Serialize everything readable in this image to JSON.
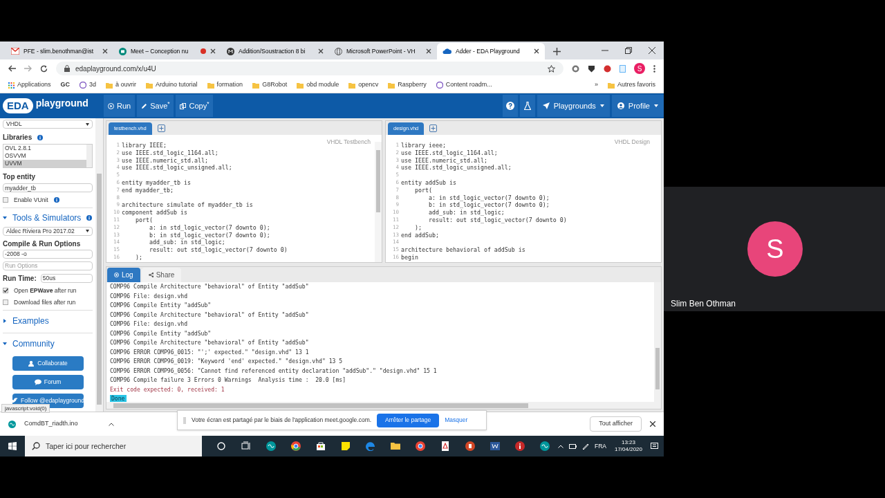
{
  "browser_tabs": [
    {
      "title": "PFE - slim.benothman@ist",
      "kind": "mail",
      "selected": false
    },
    {
      "title": "Meet – Conception nu",
      "kind": "meet",
      "selected": false
    },
    {
      "title": "Addition/Soustraction 8 bi",
      "kind": "site",
      "selected": false
    },
    {
      "title": "Microsoft PowerPoint - VH",
      "kind": "globe",
      "selected": false
    },
    {
      "title": "Adder - EDA Playground",
      "kind": "eda",
      "selected": true
    }
  ],
  "address": "edaplayground.com/x/u4U",
  "profile_initial": "S",
  "bookmarks": [
    {
      "label": "Applications",
      "kind": "apps"
    },
    {
      "label": "GC",
      "kind": "text"
    },
    {
      "label": "3d",
      "kind": "site"
    },
    {
      "label": "à ouvrir",
      "kind": "folder"
    },
    {
      "label": "Arduino tutorial",
      "kind": "folder"
    },
    {
      "label": "formation",
      "kind": "folder"
    },
    {
      "label": "G8Robot",
      "kind": "folder"
    },
    {
      "label": "obd module",
      "kind": "folder"
    },
    {
      "label": "opencv",
      "kind": "folder"
    },
    {
      "label": "Raspberry",
      "kind": "folder"
    },
    {
      "label": "Content roadm...",
      "kind": "site"
    }
  ],
  "more_bookmarks": "»",
  "other_bookmarks": "Autres favoris",
  "eda_header": {
    "logo": "EDA",
    "brand": "playground",
    "actions": [
      "Run",
      "Save$^{*}$",
      "Copy$^{*}$"
    ],
    "menus": [
      "Playgrounds",
      "Profile"
    ]
  },
  "sidebar": {
    "language": "VHDL",
    "libraries_label": "Libraries",
    "libraries": [
      {
        "name": "OVL 2.8.1",
        "selected": false
      },
      {
        "name": "OSVVM",
        "selected": false
      },
      {
        "name": "UVVM",
        "selected": true
      }
    ],
    "top_entity_label": "Top entity",
    "top_entity": "myadder_tb",
    "vunit": {
      "label": "Enable VUnit",
      "checked": false
    },
    "sections": [
      {
        "title": "Tools & Simulators",
        "expanded": true
      }
    ],
    "simulator": "Aldec Riviera Pro 2017.02",
    "compile_label": "Compile & Run Options",
    "compile_options": "-2008 -o",
    "run_options": {
      "placeholder": "Run Options"
    },
    "run_time_label": "Run Time:",
    "run_time": "50us",
    "options": [
      {
        "label": "Open **EPWave** after run",
        "checked": true
      },
      {
        "label": "Download files after run",
        "checked": false
      }
    ],
    "examples": {
      "title": "Examples",
      "expanded": false
    },
    "community": {
      "title": "Community",
      "expanded": true,
      "buttons": [
        "Collaborate",
        "Forum",
        "Follow @edaplayground"
      ]
    },
    "status_link": "javascript:void(0)"
  },
  "editors": [
    {
      "tab": "testbench.vhd",
      "label": "VHDL Testbench",
      "lines": [
        {
          "n": "1",
          "text": "library IEEE;"
        },
        {
          "n": "2",
          "text": "use IEEE.std_logic_1164.all;"
        },
        {
          "n": "3",
          "text": "use IEEE.numeric_std.all;"
        },
        {
          "n": "4",
          "text": "use IEEE.std_logic_unsigned.all;"
        },
        {
          "n": "5"
        },
        {
          "n": "6",
          "text": "entity myadder_tb is"
        },
        {
          "n": "7",
          "text": "end myadder_tb;"
        },
        {
          "n": "8"
        },
        {
          "n": "9",
          "text": "architecture simulate of myadder_tb is"
        },
        {
          "n": "10",
          "text": "component addSub is"
        },
        {
          "n": "11",
          "text": "    port("
        },
        {
          "n": "12",
          "text": "        a: in std_logic_vector(7 downto 0);"
        },
        {
          "n": "13",
          "text": "        b: in std_logic_vector(7 downto 0);"
        },
        {
          "n": "14",
          "text": "        add_sub: in std_logic;"
        },
        {
          "n": "15",
          "text": "        result: out std_logic_vector(7 downto 0)"
        },
        {
          "n": "16",
          "text": "    );"
        }
      ]
    },
    {
      "tab": "design.vhd",
      "label": "VHDL Design",
      "lines": [
        {
          "n": "1",
          "text": "library ieee;"
        },
        {
          "n": "2",
          "text": "use IEEE.std_logic_1164.all;"
        },
        {
          "n": "3",
          "text": "use IEEE.numeric_std.all;"
        },
        {
          "n": "4",
          "text": "use IEEE.std_logic_unsigned.all;"
        },
        {
          "n": "5"
        },
        {
          "n": "6",
          "text": "entity addSub is"
        },
        {
          "n": "7",
          "text": "    port("
        },
        {
          "n": "8",
          "text": "        a: in std_logic_vector(7 downto 0);"
        },
        {
          "n": "9",
          "text": "        b: in std_logic_vector(7 downto 0);"
        },
        {
          "n": "10",
          "text": "        add_sub: in std_logic;"
        },
        {
          "n": "11",
          "text": "        result: out std_logic_vector(7 downto 0)"
        },
        {
          "n": "12",
          "text": "    );"
        },
        {
          "n": "13",
          "text": "end addSub;"
        },
        {
          "n": "14"
        },
        {
          "n": "15",
          "text": "architecture behavioral of addSub is"
        },
        {
          "n": "16",
          "text": "begin"
        }
      ]
    }
  ],
  "log": {
    "tabs": [
      {
        "label": "Log",
        "selected": true
      },
      {
        "label": "Share",
        "selected": false
      }
    ],
    "lines": [
      {
        "text": "COMP96 Compile Architecture \"behavioral\" of Entity \"addSub\"",
        "kind": "info"
      },
      {
        "text": "COMP96 File: design.vhd",
        "kind": "info"
      },
      {
        "text": "COMP96 Compile Entity \"addSub\"",
        "kind": "info"
      },
      {
        "text": "COMP96 Compile Architecture \"behavioral\" of Entity \"addSub\"",
        "kind": "info"
      },
      {
        "text": "COMP96 File: design.vhd",
        "kind": "info"
      },
      {
        "text": "COMP96 Compile Entity \"addSub\"",
        "kind": "info"
      },
      {
        "text": "COMP96 Compile Architecture \"behavioral\" of Entity \"addSub\"",
        "kind": "info"
      },
      {
        "text": "COMP96 ERROR COMP96_0015: \"';' expected.\" \"design.vhd\" 13 1",
        "kind": "info"
      },
      {
        "text": "COMP96 ERROR COMP96_0019: \"Keyword 'end' expected.\" \"design.vhd\" 13 5",
        "kind": "info"
      },
      {
        "text": "COMP96 ERROR COMP96_0056: \"Cannot find referenced entity declaration \"addSub\".\" \"design.vhd\" 15 1",
        "kind": "info"
      },
      {
        "text": "COMP96 Compile failure 3 Errors 0 Warnings  Analysis time :  20.0 [ms]",
        "kind": "info"
      },
      {
        "text": "Exit code expected: 0, received: 1",
        "kind": "exit"
      }
    ],
    "done": "Done"
  },
  "download": {
    "file": "ComdBT_riadth.ino",
    "show_all": "Tout afficher"
  },
  "share_notice": {
    "text": "Votre écran est partagé par le biais de l'application meet.google.com.",
    "stop": "Arrêter le partage",
    "hide": "Masquer"
  },
  "taskbar": {
    "search": {
      "placeholder": "Taper ici pour rechercher"
    },
    "language": "FRA",
    "time": "13:23",
    "date": "17/04/2020"
  },
  "participant": {
    "initial": "S",
    "name": "Slim Ben Othman"
  }
}
